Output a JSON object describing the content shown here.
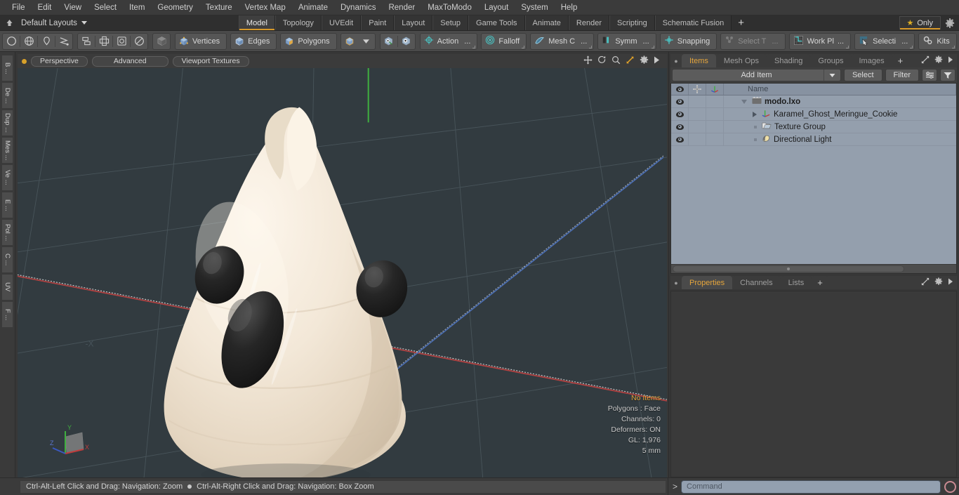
{
  "menu": {
    "items": [
      "File",
      "Edit",
      "View",
      "Select",
      "Item",
      "Geometry",
      "Texture",
      "Vertex Map",
      "Animate",
      "Dynamics",
      "Render",
      "MaxToModo",
      "Layout",
      "System",
      "Help"
    ]
  },
  "layoutbar": {
    "home_icon": "home-icon",
    "default_layouts": "Default Layouts",
    "tabs": [
      {
        "label": "Model",
        "active": true
      },
      {
        "label": "Topology",
        "active": false
      },
      {
        "label": "UVEdit",
        "active": false
      },
      {
        "label": "Paint",
        "active": false
      },
      {
        "label": "Layout",
        "active": false
      },
      {
        "label": "Setup",
        "active": false
      },
      {
        "label": "Game Tools",
        "active": false
      },
      {
        "label": "Animate",
        "active": false
      },
      {
        "label": "Render",
        "active": false
      },
      {
        "label": "Scripting",
        "active": false
      },
      {
        "label": "Schematic Fusion",
        "active": false
      }
    ],
    "add_tab": "+",
    "only_label": "Only",
    "gear_icon": "gear-icon",
    "accent_color": "#d89a2a"
  },
  "toolbar": {
    "shape_tools": [
      "circle-icon",
      "globe-icon",
      "pen-icon",
      "curve-icon"
    ],
    "arrange_tools": [
      "stack-icon",
      "align-icon",
      "center-icon",
      "shade-icon"
    ],
    "selection_modes": [
      {
        "label": "Vertices",
        "icon": "cube-vertices-icon"
      },
      {
        "label": "Edges",
        "icon": "cube-edges-icon"
      },
      {
        "label": "Polygons",
        "icon": "cube-polygons-icon"
      }
    ],
    "items": [
      {
        "label": "Action",
        "icon": "action-center-icon",
        "dim": false,
        "ellipsis": true
      },
      {
        "label": "Falloff",
        "icon": "falloff-icon",
        "dim": false,
        "ellipsis": false
      },
      {
        "label": "Mesh C",
        "icon": "mesh-constraint-icon",
        "dim": false,
        "ellipsis": true
      },
      {
        "label": "Symm",
        "icon": "symmetry-icon",
        "dim": false,
        "ellipsis": true
      },
      {
        "label": "Snapping",
        "icon": "snapping-icon",
        "dim": false,
        "ellipsis": false
      },
      {
        "label": "Select T",
        "icon": "select-through-icon",
        "dim": true,
        "ellipsis": true
      },
      {
        "label": "Work Pl",
        "icon": "work-plane-icon",
        "dim": false,
        "ellipsis": true
      },
      {
        "label": "Selecti",
        "icon": "selection-set-icon",
        "dim": false,
        "ellipsis": true
      },
      {
        "label": "Kits",
        "icon": "kits-gears-icon",
        "dim": false,
        "ellipsis": false
      }
    ],
    "right_icons": [
      "modo-cube-icon",
      "unreal-icon"
    ]
  },
  "vtabs": {
    "items": [
      "B ...",
      "De ...",
      "Dup ...",
      "Mes ...",
      "Ve ...",
      "E ...",
      "Pol ...",
      "C ...",
      "UV",
      "F ..."
    ]
  },
  "viewport": {
    "header": {
      "dot": "viewport-active-dot",
      "buttons": [
        "Perspective",
        "Advanced",
        "Viewport Textures"
      ],
      "icons": [
        "move-icon",
        "rotate-icon",
        "zoom-icon",
        "fit-icon",
        "gear-icon",
        "play-icon"
      ]
    },
    "stats": {
      "selection": "No Items",
      "polygons": "Polygons : Face",
      "channels": "Channels: 0",
      "deformers": "Deformers: ON",
      "gl": "GL: 1,976",
      "scale": "5 mm"
    },
    "axis_labels": {
      "x": "X",
      "y": "Y",
      "z": "Z"
    },
    "background_color": "#323b40",
    "model_color": "#f0e6d8",
    "model_name": "ghost-meringue-cookie"
  },
  "right_panel": {
    "top_tabs": [
      {
        "label": "Items",
        "active": true
      },
      {
        "label": "Mesh Ops",
        "active": false
      },
      {
        "label": "Shading",
        "active": false
      },
      {
        "label": "Groups",
        "active": false
      },
      {
        "label": "Images",
        "active": false
      }
    ],
    "add_tab": "+",
    "panel_icons": [
      "expand-icon",
      "gear-icon",
      "play-icon"
    ],
    "add_item": "Add Item",
    "select_button": "Select",
    "filter_button": "Filter",
    "columns": [
      "visibility-icon",
      "lock-icon",
      "axis-icon",
      "Name"
    ],
    "name_header": "Name",
    "rows": [
      {
        "name": "modo.lxo",
        "icon": "scene-icon",
        "depth": 0,
        "bold": true,
        "expander": "down"
      },
      {
        "name": "Karamel_Ghost_Meringue_Cookie",
        "icon": "mesh-axis-icon",
        "depth": 1,
        "bold": false,
        "expander": "right"
      },
      {
        "name": "Texture Group",
        "icon": "texture-group-icon",
        "depth": 1,
        "bold": false,
        "expander": "none"
      },
      {
        "name": "Directional Light",
        "icon": "light-icon",
        "depth": 1,
        "bold": false,
        "expander": "none"
      }
    ],
    "bottom_tabs": [
      {
        "label": "Properties",
        "active": true
      },
      {
        "label": "Channels",
        "active": false
      },
      {
        "label": "Lists",
        "active": false
      }
    ],
    "bottom_add_tab": "+"
  },
  "bottom": {
    "status_left": "Ctrl-Alt-Left Click and Drag: Navigation: Zoom",
    "status_right": "Ctrl-Alt-Right Click and Drag: Navigation: Box Zoom",
    "command_prompt": ">",
    "command_placeholder": "Command",
    "command_value": ""
  }
}
